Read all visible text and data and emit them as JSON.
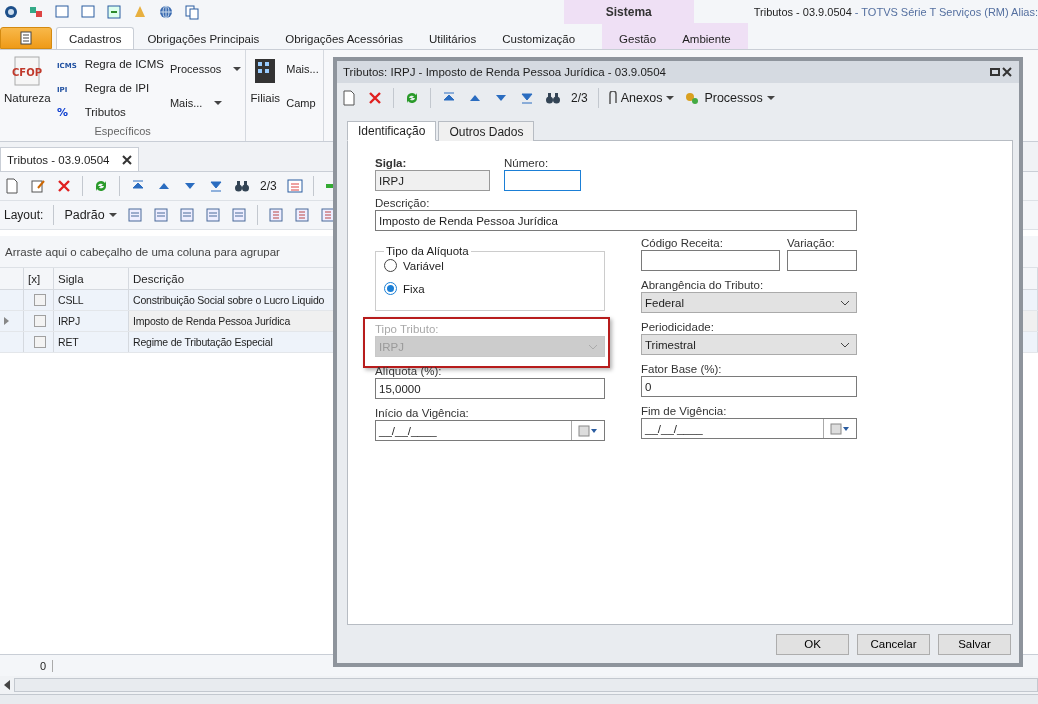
{
  "title_bar": {
    "context_tab": "Sistema",
    "document": "Tributos - 03.9.0504",
    "app": " - TOTVS Série T Serviços (RM) Alias:"
  },
  "ribbon_tabs": [
    {
      "label": "Cadastros",
      "selected": true
    },
    {
      "label": "Obrigações Principais",
      "selected": false
    },
    {
      "label": "Obrigações Acessórias",
      "selected": false
    },
    {
      "label": "Utilitários",
      "selected": false
    },
    {
      "label": "Customização",
      "selected": false
    }
  ],
  "context_tabs": [
    {
      "label": "Gestão",
      "selected": false
    },
    {
      "label": "Ambiente",
      "selected": false
    }
  ],
  "ribbon": {
    "natureza": "Natureza",
    "cfop": "CFOP",
    "small_items": [
      {
        "label": "Regra de ICMS",
        "icon": "ICMS"
      },
      {
        "label": "Regra de IPI",
        "icon": "IPI"
      },
      {
        "label": "Tributos",
        "icon": "%"
      }
    ],
    "menus": [
      "Processos",
      "Mais..."
    ],
    "group_label": "Específicos",
    "filiais": "Filiais",
    "mais": "Mais...",
    "campo": "Camp"
  },
  "document_tab": "Tributos - 03.9.0504",
  "toolbar": {
    "counter": "2/3",
    "layout_label": "Layout:",
    "layout_value": "Padrão"
  },
  "group_hint": "Arraste aqui o cabeçalho de uma coluna para agrupar",
  "grid": {
    "columns": [
      "[x]",
      "Sigla",
      "Descrição"
    ],
    "rows": [
      {
        "checked": false,
        "sigla": "CSLL",
        "descricao": "Constribuição Social sobre o Lucro Liquido",
        "selected": false
      },
      {
        "checked": false,
        "sigla": "IRPJ",
        "descricao": "Imposto de Renda Pessoa Jurídica",
        "selected": true
      },
      {
        "checked": false,
        "sigla": "RET",
        "descricao": "Regime de Tributação Especial",
        "selected": false
      }
    ]
  },
  "status_count": "0",
  "dialog": {
    "title": "Tributos: IRPJ - Imposto de Renda Pessoa Jurídica - 03.9.0504",
    "counter": "2/3",
    "anexos": "Anexos",
    "processos": "Processos",
    "tabs": [
      {
        "label": "Identificação",
        "selected": true
      },
      {
        "label": "Outros Dados",
        "selected": false
      }
    ],
    "sigla": {
      "label": "Sigla:",
      "value": "IRPJ"
    },
    "numero": {
      "label": "Número:"
    },
    "descricao": {
      "label": "Descrição:",
      "value": "Imposto de Renda Pessoa Jurídica"
    },
    "aliquota_group": {
      "title": "Tipo da Alíquota",
      "options": [
        {
          "label": "Variável",
          "selected": false
        },
        {
          "label": "Fixa",
          "selected": true
        }
      ]
    },
    "left_fields": [
      {
        "kind": "combo",
        "label": "Tipo Tributo:",
        "value": "IRPJ",
        "disabled": true,
        "highlighted": true
      },
      {
        "kind": "text",
        "label": "Alíquota (%):",
        "value": "15,0000",
        "disabled": false
      },
      {
        "kind": "date",
        "label": "Início da Vigência:",
        "value": "__/__/____",
        "disabled": false
      }
    ],
    "codigo": {
      "label": "Código Receita:"
    },
    "variacao": {
      "label": "Variação:"
    },
    "right_fields": [
      {
        "kind": "combo",
        "label": "Abrangência do Tributo:",
        "value": "Federal",
        "disabled": false
      },
      {
        "kind": "combo",
        "label": "Periodicidade:",
        "value": "Trimestral",
        "disabled": false
      },
      {
        "kind": "text",
        "label": "Fator Base (%):",
        "value": "0",
        "disabled": false
      },
      {
        "kind": "date",
        "label": "Fim de Vigência:",
        "value": "__/__/____",
        "disabled": false
      }
    ],
    "buttons": [
      "OK",
      "Cancelar",
      "Salvar"
    ]
  }
}
